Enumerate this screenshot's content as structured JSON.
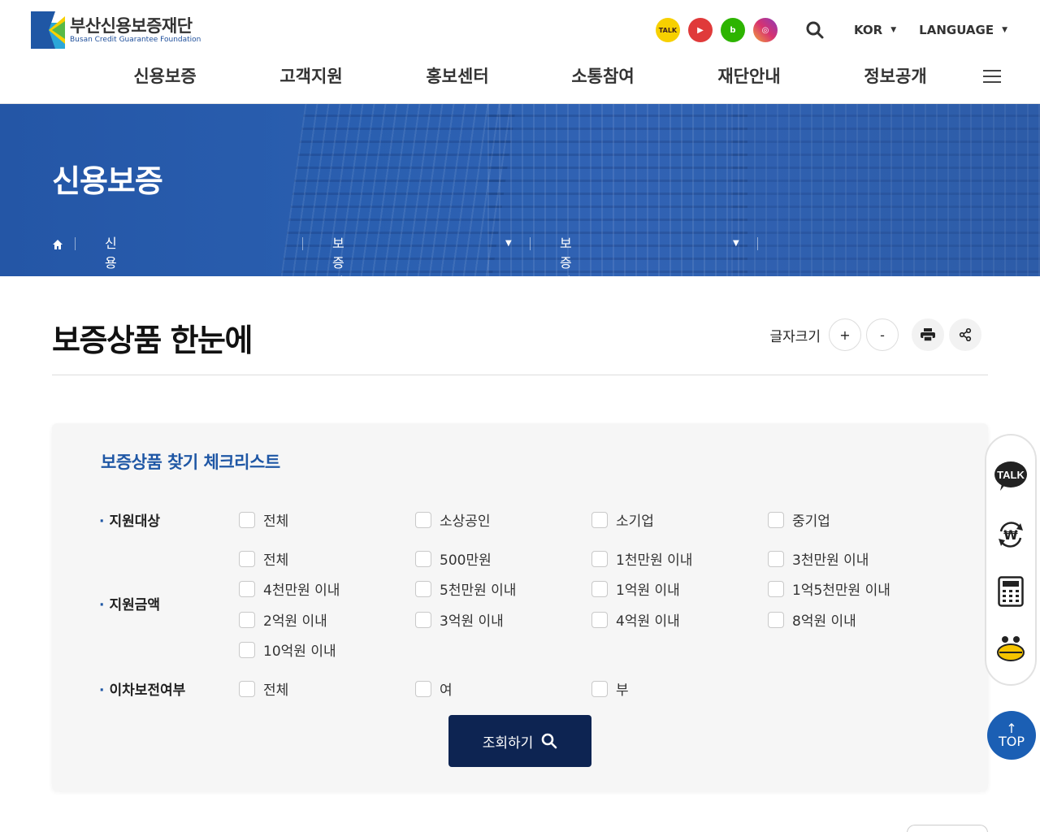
{
  "header": {
    "logo_ko": "부산신용보증재단",
    "logo_en": "Busan Credit Guarantee Foundation",
    "sns": [
      {
        "name": "kakao-talk",
        "label": "TALK"
      },
      {
        "name": "youtube",
        "label": "▶"
      },
      {
        "name": "blog",
        "label": "b"
      },
      {
        "name": "instagram",
        "label": "◎"
      }
    ],
    "lang": "KOR",
    "language": "LANGUAGE"
  },
  "gnb": [
    "신용보증",
    "고객지원",
    "홍보센터",
    "소통참여",
    "재단안내",
    "정보공개"
  ],
  "visual": {
    "title": "신용보증",
    "crumbs": [
      "신용보증",
      "보증상품안내",
      "보증상품 한눈에"
    ]
  },
  "page": {
    "title": "보증상품 한눈에",
    "font_size_label": "글자크기",
    "plus": "+",
    "minus": "-"
  },
  "checklist": {
    "title": "보증상품 찾기 체크리스트",
    "target_label": "지원대상",
    "target_options": [
      "전체",
      "소상공인",
      "소기업",
      "중기업"
    ],
    "amount_label": "지원금액",
    "amount_options": [
      "전체",
      "500만원",
      "1천만원 이내",
      "3천만원 이내",
      "4천만원 이내",
      "5천만원 이내",
      "1억원 이내",
      "1억5천만원 이내",
      "2억원 이내",
      "3억원 이내",
      "4억원 이내",
      "8억원 이내",
      "10억원 이내"
    ],
    "interest_label": "이차보전여부",
    "interest_options": [
      "전체",
      "여",
      "부"
    ],
    "search_label": "조회하기"
  },
  "quick": {
    "talk": "TALK",
    "currency": "₩",
    "top": "TOP"
  },
  "colors": {
    "accent": "#1f57a5",
    "navy": "#0d2452",
    "banner": "#2a5fb0"
  }
}
